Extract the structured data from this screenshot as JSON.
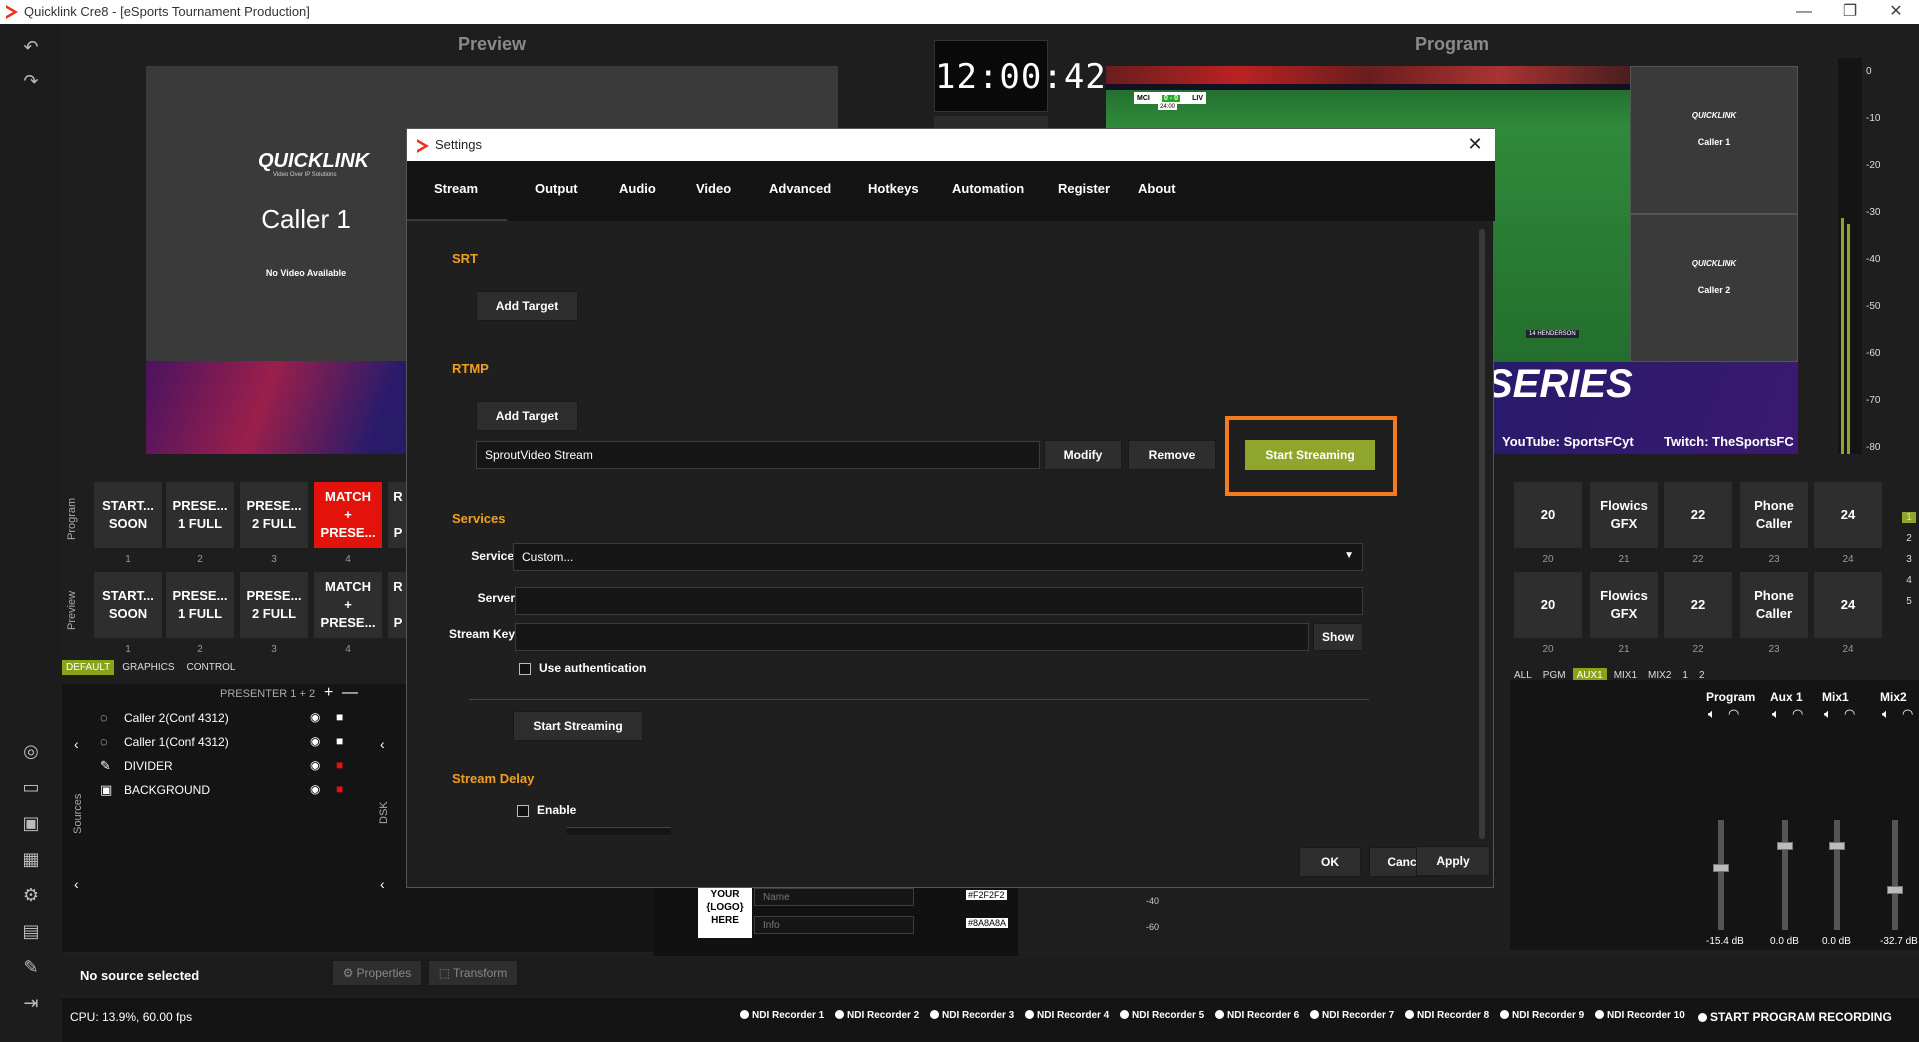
{
  "window": {
    "title": "Quicklink Cre8 - [eSports Tournament Production]",
    "minimize": "—",
    "restore": "❐",
    "close": "✕"
  },
  "preview": {
    "section_title": "Preview",
    "logo": "QUICKLINK",
    "logo_tag": "Video Over IP Solutions",
    "caller": "Caller 1",
    "no_video": "No Video Available"
  },
  "clock": "12:00:42",
  "program": {
    "section_title": "Program",
    "cam1_logo": "QUICKLINK",
    "cam1_label": "Caller 1",
    "cam2_logo": "QUICKLINK",
    "cam2_label": "Caller 2",
    "series_text": "SERIES",
    "social_youtube": "YouTube: SportsFCyt",
    "social_twitch": "Twitch: TheSportsFC",
    "score_home": "MCI",
    "score": "0 - 0",
    "score_away": "LIV",
    "score_time": "24:00",
    "player_tag": "14 HENDERSON"
  },
  "vu_scale": [
    "0",
    "-10",
    "-20",
    "-30",
    "-40",
    "-50",
    "-60",
    "-70",
    "-80"
  ],
  "scenes": {
    "program_label": "Program",
    "preview_label": "Preview",
    "left": [
      {
        "label": "START...\nSOON",
        "num": "1"
      },
      {
        "label": "PRESE...\n1 FULL",
        "num": "2"
      },
      {
        "label": "PRESE...\n2 FULL",
        "num": "3"
      },
      {
        "label": "MATCH\n+\nPRESE...",
        "num": "4"
      },
      {
        "label": "R\n\nP",
        "num": ""
      }
    ],
    "right": [
      {
        "label": "20",
        "num": "20"
      },
      {
        "label": "Flowics\nGFX",
        "num": "21"
      },
      {
        "label": "22",
        "num": "22"
      },
      {
        "label": "Phone\nCaller",
        "num": "23"
      },
      {
        "label": "24",
        "num": "24"
      }
    ],
    "side_numbers": [
      "1",
      "2",
      "3",
      "4",
      "5"
    ]
  },
  "scene_tabs": [
    "DEFAULT",
    "GRAPHICS",
    "CONTROL"
  ],
  "bus_tabs": [
    "ALL",
    "PGM",
    "AUX1",
    "MIX1",
    "MIX2",
    "1",
    "2"
  ],
  "sources": {
    "header": "PRESENTER 1 + 2",
    "panel_label": "Sources",
    "dsk_label": "DSK",
    "items": [
      "Caller 2(Conf 4312)",
      "Caller 1(Conf 4312)",
      "DIVIDER",
      "BACKGROUND"
    ]
  },
  "graphics_editor": {
    "logo_text": "YOUR\n{LOGO}\nHERE",
    "name_placeholder": "Name",
    "info_placeholder": "Info",
    "name_color": "#F2F2F2",
    "info_color": "#8A8A8A"
  },
  "mixer": {
    "channels": [
      {
        "name": "Program",
        "db": "-15.4 dB"
      },
      {
        "name": "Aux 1",
        "db": "0.0 dB"
      },
      {
        "name": "Mix1",
        "db": "0.0 dB"
      },
      {
        "name": "Mix2",
        "db": "-32.7 dB"
      }
    ],
    "scale": [
      "-40",
      "-60"
    ]
  },
  "status": {
    "no_source": "No source selected",
    "properties": "Properties",
    "transform": "Transform",
    "cpu": "CPU: 13.9%, 60.00 fps",
    "recorders": [
      "NDI Recorder 1",
      "NDI Recorder 2",
      "NDI Recorder 3",
      "NDI Recorder 4",
      "NDI Recorder 5",
      "NDI Recorder 6",
      "NDI Recorder 7",
      "NDI Recorder 8",
      "NDI Recorder 9",
      "NDI Recorder 10"
    ],
    "start_recording": "START PROGRAM RECORDING"
  },
  "settings": {
    "title": "Settings",
    "close": "✕",
    "tabs": [
      "Stream",
      "Output",
      "Audio",
      "Video",
      "Advanced",
      "Hotkeys",
      "Automation",
      "Register",
      "About"
    ],
    "srt_label": "SRT",
    "srt_add_target": "Add Target",
    "rtmp_label": "RTMP",
    "rtmp_add_target": "Add Target",
    "rtmp_target_name": "SproutVideo Stream",
    "modify": "Modify",
    "remove": "Remove",
    "start_streaming_target": "Start Streaming",
    "services_label": "Services",
    "service_label": "Service",
    "service_value": "Custom...",
    "server_label": "Server",
    "server_value": "",
    "stream_key_label": "Stream Key",
    "stream_key_value": "",
    "show": "Show",
    "use_auth": "Use authentication",
    "start_streaming": "Start Streaming",
    "stream_delay_label": "Stream Delay",
    "enable": "Enable",
    "ok": "OK",
    "cancel": "Cancel",
    "apply": "Apply"
  },
  "colors": {
    "accent_green": "#8fa52b",
    "highlight_orange": "#f47b20",
    "section_orange": "#f0a020",
    "active_red": "#e3120b"
  }
}
